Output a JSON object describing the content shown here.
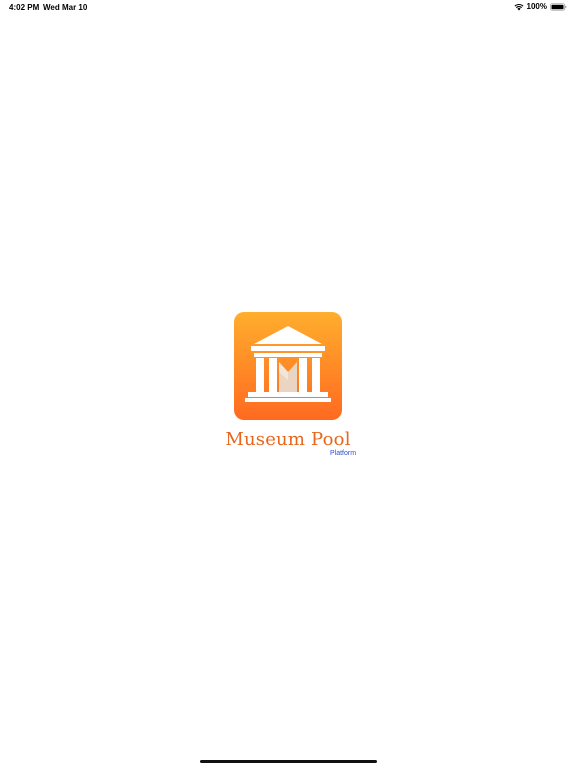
{
  "status_bar": {
    "time": "4:02 PM",
    "date": "Wed Mar 10",
    "battery_percent": "100%",
    "battery_level": 1.0,
    "icons": [
      "wifi-icon",
      "battery-icon"
    ]
  },
  "splash": {
    "logo_icon": "museum-building-icon",
    "brand_name": "Museum Pool",
    "brand_subtitle": "Platform"
  },
  "colors": {
    "logo_gradient_top": "#ffae2d",
    "logo_gradient_bottom": "#ff6a20",
    "brand_name": "#e8661c",
    "brand_subtitle": "#2c4fd8",
    "background": "#ffffff"
  }
}
